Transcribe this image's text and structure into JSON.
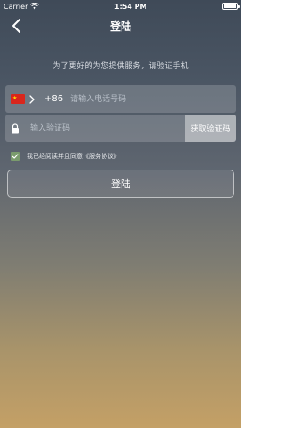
{
  "status_bar": {
    "carrier": "Carrier",
    "time": "1:54 PM"
  },
  "nav": {
    "title": "登陆"
  },
  "subtitle": "为了更好的为您提供服务，请验证手机",
  "phone": {
    "country_code": "+86",
    "placeholder": "请输入电话号码",
    "flag_icon": "china-flag-icon"
  },
  "verification": {
    "placeholder": "输入验证码",
    "get_code_label": "获取验证码"
  },
  "agreement": {
    "text": "我已经阅读并且同意《服务协议》",
    "checked": true
  },
  "login_button_label": "登陆",
  "colors": {
    "checkbox_green": "#7a9b6d",
    "flag_red": "#d9261c"
  }
}
